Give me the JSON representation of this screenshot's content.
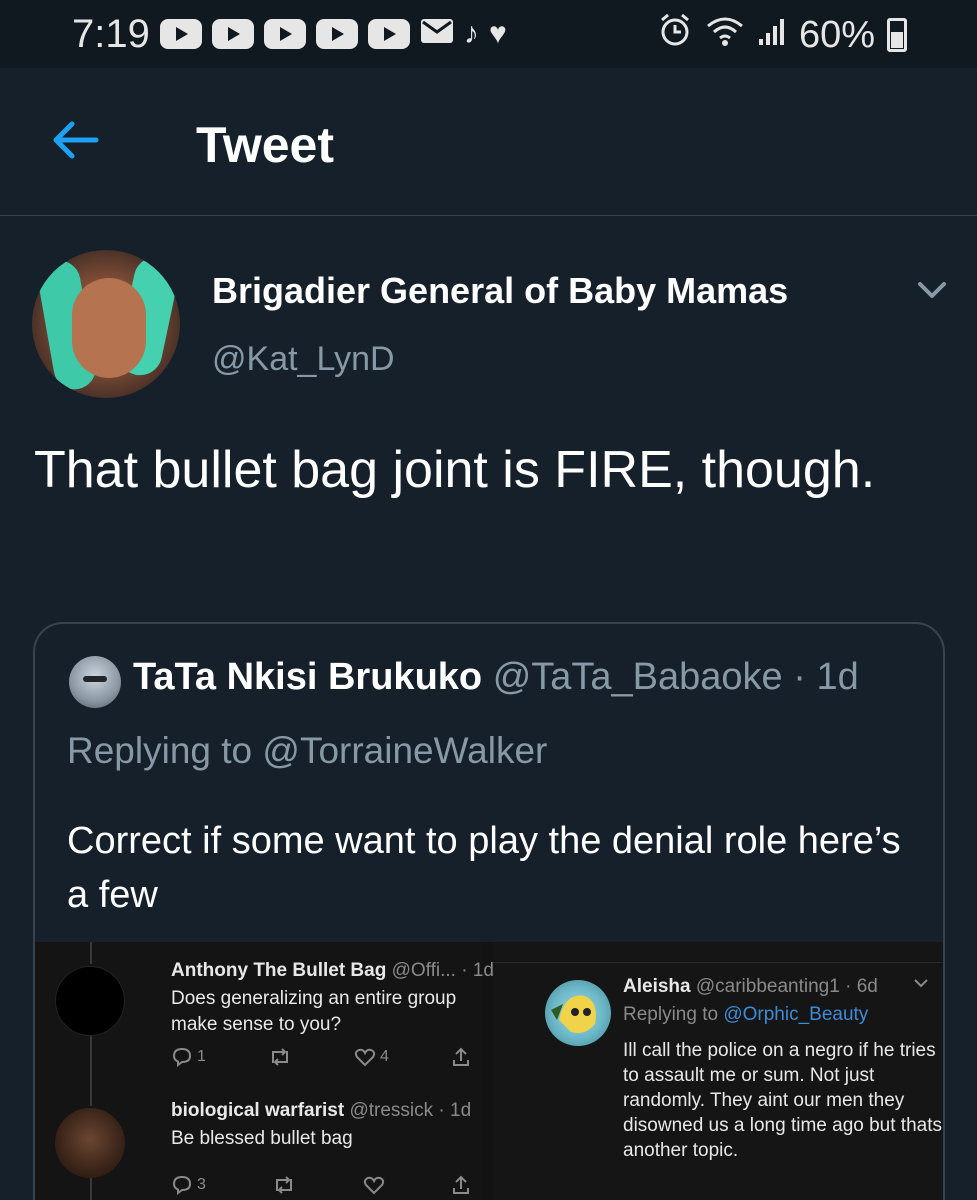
{
  "status_bar": {
    "time": "7:19",
    "battery": "60%",
    "notification_icons": [
      "youtube-icon",
      "youtube-icon",
      "youtube-icon",
      "youtube-icon",
      "youtube-icon",
      "mail-icon",
      "music-icon",
      "heart-icon"
    ]
  },
  "header": {
    "title": "Tweet"
  },
  "tweet": {
    "author_name": "Brigadier General of Baby Mamas",
    "author_handle": "@Kat_LynD",
    "text": "That bullet bag joint is FIRE, though."
  },
  "quoted_tweet": {
    "author_name": "TaTa Nkisi Brukuko",
    "handle_time": "@TaTa_Babaoke · 1d",
    "replying_label": "Replying to",
    "replying_to": "@TorraineWalker",
    "text": "Correct if some want to play the denial role here’s a few"
  },
  "embedded_image": {
    "left": {
      "reply1": {
        "name": "Anthony The Bullet Bag",
        "meta": "@Offi... · 1d",
        "text": "Does generalizing an entire group make sense to you?",
        "replies": "1",
        "likes": "4"
      },
      "reply2": {
        "name": "biological warfarist",
        "meta": "@tressick · 1d",
        "text": "Be blessed bullet bag",
        "replies": "3"
      }
    },
    "right": {
      "name": "Aleisha",
      "meta": "@caribbeanting1 · 6d",
      "replying_label": "Replying to",
      "replying_to": "@Orphic_Beauty",
      "text": "Ill call the police on a negro if he tries to assault me or sum. Not just randomly. They aint our men they disowned us a long time ago but thats another topic."
    }
  },
  "colors": {
    "background": "#15202b",
    "accent": "#1da1f2",
    "muted": "#8899a6",
    "border": "#38444d"
  }
}
